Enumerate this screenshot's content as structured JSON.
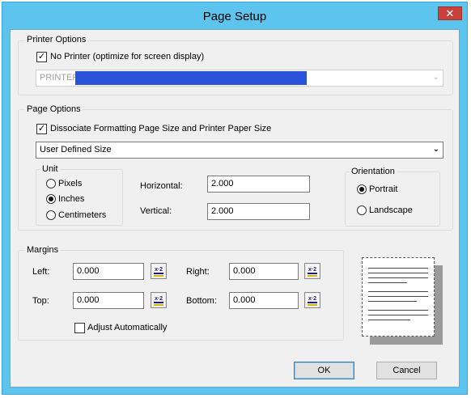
{
  "window": {
    "title": "Page Setup",
    "close_glyph": "✕"
  },
  "printer_options": {
    "title": "Printer Options",
    "no_printer_label": "No Printer (optimize for screen display)",
    "no_printer_checked": true,
    "printer_select_value": "PRINTER"
  },
  "page_options": {
    "title": "Page Options",
    "dissociate_label": "Dissociate Formatting Page Size and Printer Paper Size",
    "dissociate_checked": true,
    "size_select_value": "User Defined Size",
    "unit": {
      "title": "Unit",
      "options": [
        "Pixels",
        "Inches",
        "Centimeters"
      ],
      "selected": "Inches"
    },
    "horizontal": {
      "label": "Horizontal:",
      "value": "2.000"
    },
    "vertical": {
      "label": "Vertical:",
      "value": "2.000"
    },
    "orientation": {
      "title": "Orientation",
      "options": [
        "Portrait",
        "Landscape"
      ],
      "selected": "Portrait"
    }
  },
  "margins": {
    "title": "Margins",
    "left": {
      "label": "Left:",
      "value": "0.000"
    },
    "right": {
      "label": "Right:",
      "value": "0.000"
    },
    "top": {
      "label": "Top:",
      "value": "0.000"
    },
    "bottom": {
      "label": "Bottom:",
      "value": "0.000"
    },
    "adjust_label": "Adjust Automatically",
    "adjust_checked": false,
    "calc_icon_text": "x·2"
  },
  "buttons": {
    "ok": "OK",
    "cancel": "Cancel"
  },
  "icons": {
    "close": "close-icon",
    "checkmark": "checkmark-icon",
    "dropdown": "chevron-down-icon",
    "calculator": "calculator-icon",
    "page_preview": "page-preview-icon"
  },
  "colors": {
    "titlebar": "#5cc4ed",
    "close_button": "#c7423a",
    "dialog_background": "#f0f0f0",
    "redaction": "#2a52d8"
  }
}
